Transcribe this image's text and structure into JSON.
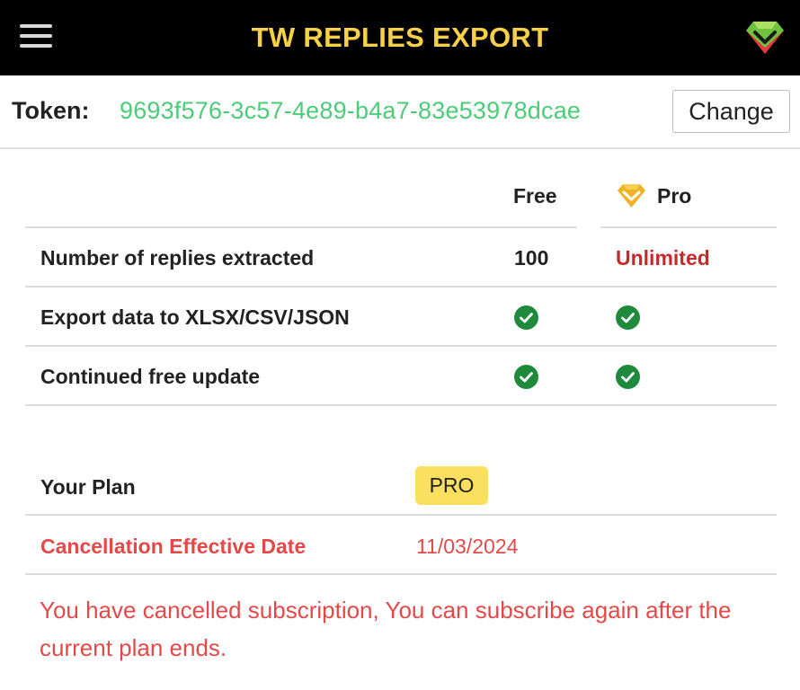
{
  "header": {
    "title": "TW REPLIES EXPORT",
    "menu_icon": "hamburger-menu-icon",
    "logo_icon": "gem-logo-icon"
  },
  "token": {
    "label": "Token:",
    "value": "9693f576-3c57-4e89-b4a7-83e53978dcae",
    "change_label": "Change"
  },
  "comparison": {
    "columns": [
      "Free",
      "Pro"
    ],
    "pro_icon": "gem-icon",
    "rows": [
      {
        "feature": "Number of replies extracted",
        "free": "100",
        "pro": "Unlimited"
      },
      {
        "feature": "Export data to XLSX/CSV/JSON",
        "free": "check",
        "pro": "check"
      },
      {
        "feature": "Continued free update",
        "free": "check",
        "pro": "check"
      }
    ]
  },
  "plan": {
    "label": "Your Plan",
    "value": "PRO",
    "cancel_label": "Cancellation Effective Date",
    "cancel_date": "11/03/2024"
  },
  "notice": "You have cancelled subscription, You can subscribe again after the current plan ends.",
  "colors": {
    "header_bg": "#000000",
    "title": "#f7d04a",
    "token": "#4ccc78",
    "unlimited": "#c42a2a",
    "warning": "#e24a4a",
    "check": "#1f8a3c",
    "badge": "#fbe060"
  }
}
